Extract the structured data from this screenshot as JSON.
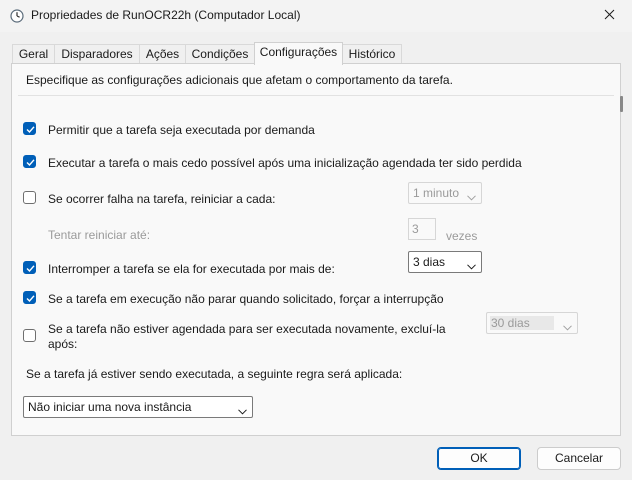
{
  "window": {
    "title": "Propriedades de RunOCR22h (Computador Local)",
    "close_glyph": "✕"
  },
  "tabs": [
    {
      "label": "Geral"
    },
    {
      "label": "Disparadores"
    },
    {
      "label": "Ações"
    },
    {
      "label": "Condições"
    },
    {
      "label": "Configurações",
      "active": true
    },
    {
      "label": "Histórico"
    }
  ],
  "settings": {
    "description": "Especifique as configurações adicionais que afetam o comportamento da tarefa.",
    "allow_on_demand": {
      "label": "Permitir que a tarefa seja executada por demanda",
      "checked": true
    },
    "run_asap": {
      "label": "Executar a tarefa o mais cedo possível após uma inicialização agendada ter sido perdida",
      "checked": true
    },
    "restart_on_fail": {
      "label": "Se ocorrer falha na tarefa, reiniciar a cada:",
      "checked": false,
      "interval": "1 minuto"
    },
    "restart_attempts": {
      "label": "Tentar reiniciar até:",
      "value": "3",
      "unit": "vezes"
    },
    "stop_if_longer": {
      "label": "Interromper a tarefa se ela for executada por mais de:",
      "checked": true,
      "duration": "3 dias"
    },
    "force_stop": {
      "label": "Se a tarefa em execução não parar quando solicitado, forçar a interrupção",
      "checked": true
    },
    "delete_if_not_scheduled": {
      "label_line1": "Se a tarefa não estiver agendada para ser executada novamente, excluí-la",
      "label_line2": "após:",
      "checked": false,
      "duration": "30 dias"
    },
    "running_rule_label": "Se a tarefa já estiver sendo executada, a seguinte regra será aplicada:",
    "running_rule_value": "Não iniciar uma nova instância"
  },
  "buttons": {
    "ok": "OK",
    "cancel": "Cancelar"
  },
  "colors": {
    "accent": "#005fb8"
  },
  "icons": {
    "app": "clock-icon",
    "close": "close-icon",
    "check": "checkmark-icon",
    "dropdown": "chevron-down-icon"
  }
}
